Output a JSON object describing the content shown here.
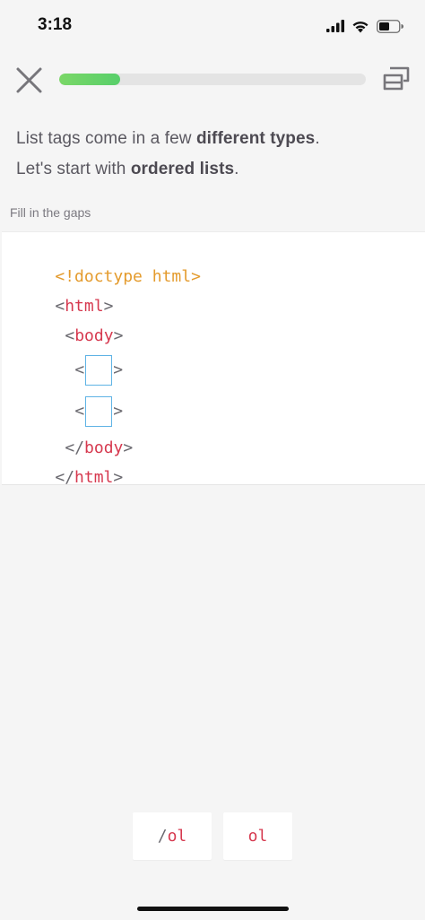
{
  "status_bar": {
    "time": "3:18",
    "icons": [
      "signal-icon",
      "wifi-icon",
      "battery-icon"
    ]
  },
  "header": {
    "close_icon": "close-icon",
    "glossary_icon": "glossary-icon",
    "progress": 0.2
  },
  "instruction": {
    "line1_start": "List tags come in a few ",
    "line1_bold": "different types",
    "line1_end": ".",
    "line2_start": "Let's start with ",
    "line2_bold": "ordered lists",
    "line2_end": "."
  },
  "hint": "Fill in the gaps",
  "code": {
    "doctype": "<!doctype html>",
    "lt": "<",
    "gt": ">",
    "slash_lt": "</",
    "html_tag": "html",
    "body_tag": "body"
  },
  "answers": {
    "option1_slash": "/",
    "option1_text": "ol",
    "option2_text": "ol"
  },
  "colors": {
    "progress": "#58cf6a",
    "doctype": "#e49b2d",
    "tag": "#d6394f",
    "gap_border": "#5fb3e5"
  }
}
